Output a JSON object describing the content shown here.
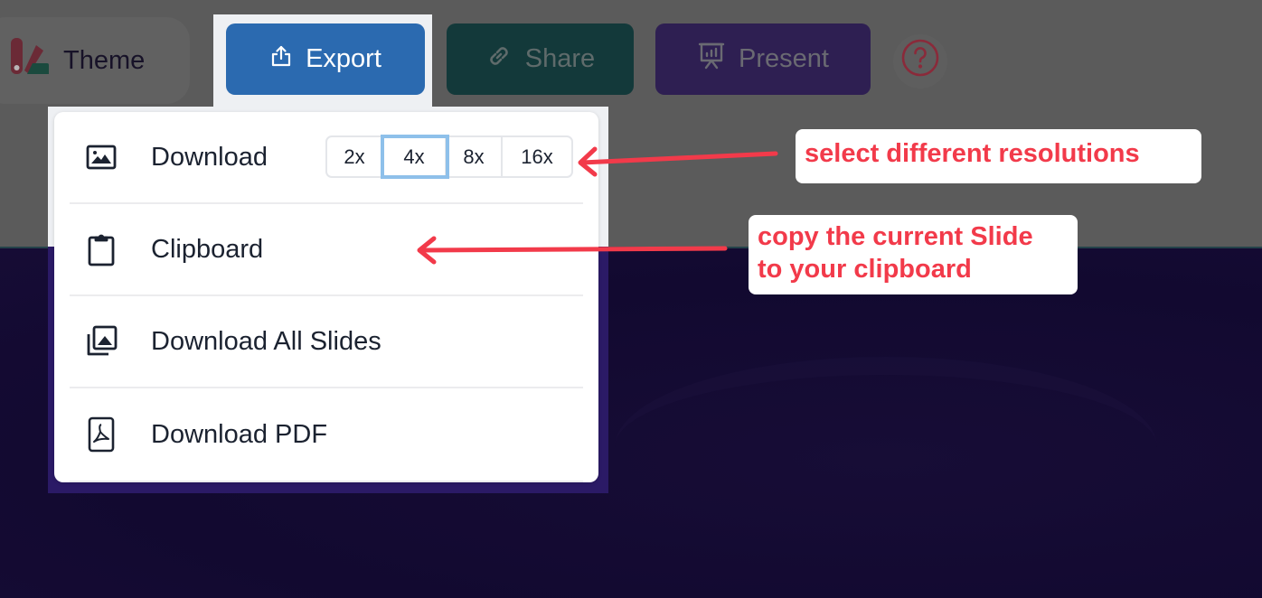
{
  "toolbar": {
    "theme_label": "Theme",
    "export_label": "Export",
    "share_label": "Share",
    "present_label": "Present",
    "help_icon": "question-circle-icon",
    "colors": {
      "export": "#2b6ab0",
      "share": "#13393a",
      "present": "#2e1f52",
      "help": "#8a2a3a"
    }
  },
  "export_menu": {
    "items": [
      {
        "label": "Download",
        "icon": "image-icon"
      },
      {
        "label": "Clipboard",
        "icon": "clipboard-icon"
      },
      {
        "label": "Download All Slides",
        "icon": "images-stack-icon"
      },
      {
        "label": "Download PDF",
        "icon": "pdf-file-icon"
      }
    ],
    "resolutions": [
      {
        "label": "2x",
        "selected": false
      },
      {
        "label": "4x",
        "selected": true
      },
      {
        "label": "8x",
        "selected": false
      },
      {
        "label": "16x",
        "selected": false
      }
    ]
  },
  "annotations": {
    "resolutions_note": "select different resolutions",
    "clipboard_note_line1": "copy the current Slide",
    "clipboard_note_line2": "to your clipboard",
    "color": "#f23a4a"
  }
}
